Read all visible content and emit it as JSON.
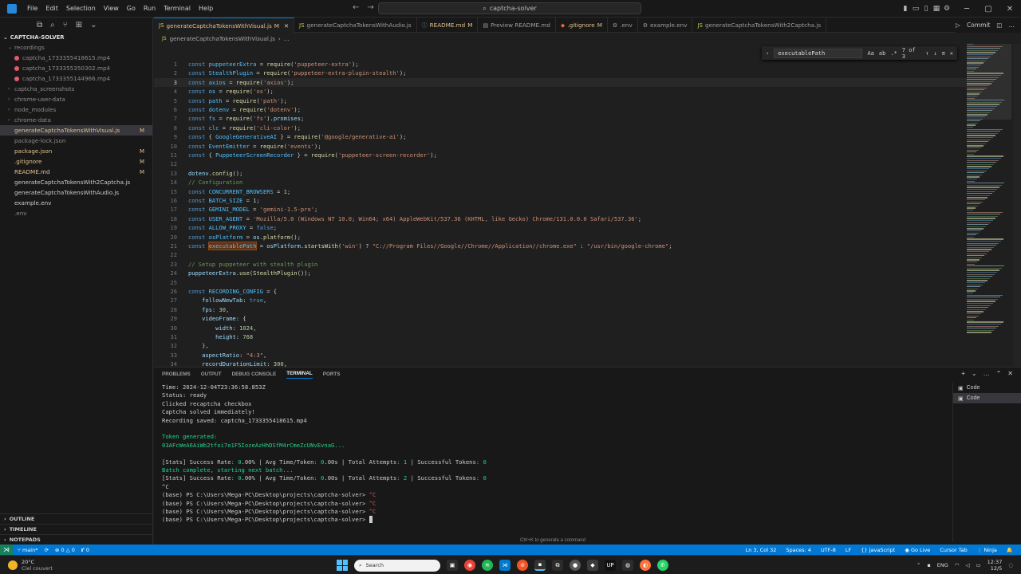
{
  "titlebar": {
    "menu": [
      "File",
      "Edit",
      "Selection",
      "View",
      "Go",
      "Run",
      "Terminal",
      "Help"
    ],
    "search": "captcha-solver"
  },
  "explorer": {
    "root": "CAPTCHA-SOLVER",
    "items": [
      {
        "label": "recordings",
        "type": "folder",
        "open": true,
        "indent": 1,
        "color": "#8c8c8c"
      },
      {
        "label": "captcha_1733355418615.mp4",
        "type": "mp4",
        "indent": 2,
        "color": "#8c8c8c"
      },
      {
        "label": "captcha_1733355350302.mp4",
        "type": "mp4",
        "indent": 2,
        "color": "#8c8c8c"
      },
      {
        "label": "captcha_1733355144966.mp4",
        "type": "mp4",
        "indent": 2,
        "color": "#8c8c8c"
      },
      {
        "label": "captcha_screenshots",
        "type": "folder",
        "indent": 1,
        "color": "#8c8c8c"
      },
      {
        "label": "chrome-user-data",
        "type": "folder",
        "indent": 1,
        "color": "#8c8c8c"
      },
      {
        "label": "node_modules",
        "type": "folder",
        "indent": 1,
        "color": "#8c8c8c"
      },
      {
        "label": "chrome-data",
        "type": "folder",
        "indent": 1,
        "color": "#8c8c8c"
      },
      {
        "label": "generateCaptchaTokensWithVisual.js",
        "type": "js",
        "indent": 1,
        "color": "#e2c08d",
        "badge": "M",
        "active": true
      },
      {
        "label": "package-lock.json",
        "type": "json",
        "indent": 1,
        "color": "#8c8c8c"
      },
      {
        "label": "package.json",
        "type": "json",
        "indent": 1,
        "color": "#e2c08d",
        "badge": "M"
      },
      {
        "label": ".gitignore",
        "type": "git",
        "indent": 1,
        "color": "#e2c08d",
        "badge": "M"
      },
      {
        "label": "README.md",
        "type": "md",
        "indent": 1,
        "color": "#e2c08d",
        "badge": "M"
      },
      {
        "label": "generateCaptchaTokensWith2Captcha.js",
        "type": "js",
        "indent": 1,
        "color": "#cccccc"
      },
      {
        "label": "generateCaptchaTokensWithAudio.js",
        "type": "js",
        "indent": 1,
        "color": "#cccccc"
      },
      {
        "label": "example.env",
        "type": "env",
        "indent": 1,
        "color": "#cccccc"
      },
      {
        "label": ".env",
        "type": "env",
        "indent": 1,
        "color": "#8c8c8c"
      }
    ],
    "bottom": [
      "OUTLINE",
      "TIMELINE",
      "NOTEPADS"
    ]
  },
  "tabs": [
    {
      "label": "generateCaptchaTokensWithVisual.js",
      "mod": "M",
      "active": true,
      "icon": "JS",
      "iconColor": "#cbcb41"
    },
    {
      "label": "generateCaptchaTokensWithAudio.js",
      "icon": "JS",
      "iconColor": "#cbcb41"
    },
    {
      "label": "README.md",
      "mod": "M",
      "icon": "ⓘ",
      "iconColor": "#519aba"
    },
    {
      "label": "Preview README.md",
      "icon": "▤",
      "iconColor": "#9d9d9d"
    },
    {
      "label": ".gitignore",
      "mod": "M",
      "icon": "◆",
      "iconColor": "#e4672f"
    },
    {
      "label": ".env",
      "icon": "⚙",
      "iconColor": "#9d9d9d"
    },
    {
      "label": "example.env",
      "icon": "⚙",
      "iconColor": "#9d9d9d"
    },
    {
      "label": "generateCaptchaTokensWith2Captcha.js",
      "icon": "JS",
      "iconColor": "#cbcb41"
    }
  ],
  "tab_actions": {
    "commit": "Commit"
  },
  "breadcrumb": [
    "generateCaptchaTokensWithVisual.js",
    "..."
  ],
  "find": {
    "query": "executablePath",
    "count": "7 of 3",
    "aa": "Aa",
    "ab": "ab",
    "re": ".*"
  },
  "code": [
    [
      [
        "k",
        "const "
      ],
      [
        "v",
        "puppeteerExtra"
      ],
      [
        "p",
        " = "
      ],
      [
        "f",
        "require"
      ],
      [
        "p",
        "("
      ],
      [
        "s",
        "'puppeteer-extra'"
      ],
      [
        "p",
        ");"
      ]
    ],
    [
      [
        "k",
        "const "
      ],
      [
        "v",
        "StealthPlugin"
      ],
      [
        "p",
        " = "
      ],
      [
        "f",
        "require"
      ],
      [
        "p",
        "("
      ],
      [
        "s",
        "'puppeteer-extra-plugin-stealth'"
      ],
      [
        "p",
        ");"
      ]
    ],
    [
      [
        "k",
        "const "
      ],
      [
        "v",
        "axios"
      ],
      [
        "p",
        " = "
      ],
      [
        "f",
        "require"
      ],
      [
        "p",
        "("
      ],
      [
        "s",
        "'axios'"
      ],
      [
        "p",
        ");"
      ]
    ],
    [
      [
        "k",
        "const "
      ],
      [
        "v",
        "os"
      ],
      [
        "p",
        " = "
      ],
      [
        "f",
        "require"
      ],
      [
        "p",
        "("
      ],
      [
        "s",
        "'os'"
      ],
      [
        "p",
        ");"
      ]
    ],
    [
      [
        "k",
        "const "
      ],
      [
        "v",
        "path"
      ],
      [
        "p",
        " = "
      ],
      [
        "f",
        "require"
      ],
      [
        "p",
        "("
      ],
      [
        "s",
        "'path'"
      ],
      [
        "p",
        ");"
      ]
    ],
    [
      [
        "k",
        "const "
      ],
      [
        "v",
        "dotenv"
      ],
      [
        "p",
        " = "
      ],
      [
        "f",
        "require"
      ],
      [
        "p",
        "("
      ],
      [
        "s",
        "'dotenv'"
      ],
      [
        "p",
        ");"
      ]
    ],
    [
      [
        "k",
        "const "
      ],
      [
        "v",
        "fs"
      ],
      [
        "p",
        " = "
      ],
      [
        "f",
        "require"
      ],
      [
        "p",
        "("
      ],
      [
        "s",
        "'fs'"
      ],
      [
        "p",
        ")."
      ],
      [
        "pr",
        "promises"
      ],
      [
        "p",
        ";"
      ]
    ],
    [
      [
        "k",
        "const "
      ],
      [
        "v",
        "clc"
      ],
      [
        "p",
        " = "
      ],
      [
        "f",
        "require"
      ],
      [
        "p",
        "("
      ],
      [
        "s",
        "'cli-color'"
      ],
      [
        "p",
        ");"
      ]
    ],
    [
      [
        "k",
        "const "
      ],
      [
        "p",
        "{ "
      ],
      [
        "v",
        "GoogleGenerativeAI"
      ],
      [
        "p",
        " } = "
      ],
      [
        "f",
        "require"
      ],
      [
        "p",
        "("
      ],
      [
        "s",
        "'@google/generative-ai'"
      ],
      [
        "p",
        ");"
      ]
    ],
    [
      [
        "k",
        "const "
      ],
      [
        "v",
        "EventEmitter"
      ],
      [
        "p",
        " = "
      ],
      [
        "f",
        "require"
      ],
      [
        "p",
        "("
      ],
      [
        "s",
        "'events'"
      ],
      [
        "p",
        ");"
      ]
    ],
    [
      [
        "k",
        "const "
      ],
      [
        "p",
        "{ "
      ],
      [
        "v",
        "PuppeteerScreenRecorder"
      ],
      [
        "p",
        " } = "
      ],
      [
        "f",
        "require"
      ],
      [
        "p",
        "("
      ],
      [
        "s",
        "'puppeteer-screen-recorder'"
      ],
      [
        "p",
        ");"
      ]
    ],
    [],
    [
      [
        "pr",
        "dotenv"
      ],
      [
        "p",
        "."
      ],
      [
        "f",
        "config"
      ],
      [
        "p",
        "();"
      ]
    ],
    [
      [
        "c",
        "// Configuration"
      ]
    ],
    [
      [
        "k",
        "const "
      ],
      [
        "v",
        "CONCURRENT_BROWSERS"
      ],
      [
        "p",
        " = "
      ],
      [
        "n",
        "1"
      ],
      [
        "p",
        ";"
      ]
    ],
    [
      [
        "k",
        "const "
      ],
      [
        "v",
        "BATCH_SIZE"
      ],
      [
        "p",
        " = "
      ],
      [
        "n",
        "1"
      ],
      [
        "p",
        ";"
      ]
    ],
    [
      [
        "k",
        "const "
      ],
      [
        "v",
        "GEMINI_MODEL"
      ],
      [
        "p",
        " = "
      ],
      [
        "s",
        "'gemini-1.5-pro'"
      ],
      [
        "p",
        ";"
      ]
    ],
    [
      [
        "k",
        "const "
      ],
      [
        "v",
        "USER_AGENT"
      ],
      [
        "p",
        " = "
      ],
      [
        "s",
        "'Mozilla/5.0 (Windows NT 10.0; Win64; x64) AppleWebKit/537.36 (KHTML, like Gecko) Chrome/131.0.0.0 Safari/537.36'"
      ],
      [
        "p",
        ";"
      ]
    ],
    [
      [
        "k",
        "const "
      ],
      [
        "v",
        "ALLOW_PROXY"
      ],
      [
        "p",
        " = "
      ],
      [
        "b",
        "false"
      ],
      [
        "p",
        ";"
      ]
    ],
    [
      [
        "k",
        "const "
      ],
      [
        "v",
        "osPlatform"
      ],
      [
        "p",
        " = "
      ],
      [
        "pr",
        "os"
      ],
      [
        "p",
        "."
      ],
      [
        "f",
        "platform"
      ],
      [
        "p",
        "();"
      ]
    ],
    [
      [
        "k",
        "const "
      ],
      [
        "h",
        "executablePath"
      ],
      [
        "p",
        " = "
      ],
      [
        "pr",
        "osPlatform"
      ],
      [
        "p",
        "."
      ],
      [
        "f",
        "startsWith"
      ],
      [
        "p",
        "("
      ],
      [
        "s",
        "'win'"
      ],
      [
        "p",
        ") ? "
      ],
      [
        "s",
        "\"C://Program Files//Google//Chrome//Application//chrome.exe\""
      ],
      [
        "p",
        " : "
      ],
      [
        "s",
        "\"/usr/bin/google-chrome\""
      ],
      [
        "p",
        ";"
      ]
    ],
    [],
    [
      [
        "c",
        "// Setup puppeteer with stealth plugin"
      ]
    ],
    [
      [
        "pr",
        "puppeteerExtra"
      ],
      [
        "p",
        "."
      ],
      [
        "f",
        "use"
      ],
      [
        "p",
        "("
      ],
      [
        "f",
        "StealthPlugin"
      ],
      [
        "p",
        "());"
      ]
    ],
    [],
    [
      [
        "k",
        "const "
      ],
      [
        "v",
        "RECORDING_CONFIG"
      ],
      [
        "p",
        " = {"
      ]
    ],
    [
      [
        "p",
        "    "
      ],
      [
        "pr",
        "followNewTab"
      ],
      [
        "p",
        ": "
      ],
      [
        "b",
        "true"
      ],
      [
        "p",
        ","
      ]
    ],
    [
      [
        "p",
        "    "
      ],
      [
        "pr",
        "fps"
      ],
      [
        "p",
        ": "
      ],
      [
        "n",
        "30"
      ],
      [
        "p",
        ","
      ]
    ],
    [
      [
        "p",
        "    "
      ],
      [
        "pr",
        "videoFrame"
      ],
      [
        "p",
        ": {"
      ]
    ],
    [
      [
        "p",
        "        "
      ],
      [
        "pr",
        "width"
      ],
      [
        "p",
        ": "
      ],
      [
        "n",
        "1024"
      ],
      [
        "p",
        ","
      ]
    ],
    [
      [
        "p",
        "        "
      ],
      [
        "pr",
        "height"
      ],
      [
        "p",
        ": "
      ],
      [
        "n",
        "768"
      ]
    ],
    [
      [
        "p",
        "    },"
      ]
    ],
    [
      [
        "p",
        "    "
      ],
      [
        "pr",
        "aspectRatio"
      ],
      [
        "p",
        ": "
      ],
      [
        "s",
        "\"4:3\""
      ],
      [
        "p",
        ","
      ]
    ],
    [
      [
        "p",
        "    "
      ],
      [
        "pr",
        "recordDurationLimit"
      ],
      [
        "p",
        ": "
      ],
      [
        "n",
        "300"
      ],
      [
        "p",
        ","
      ]
    ]
  ],
  "cursor_line": 3,
  "panel": {
    "tabs": [
      "PROBLEMS",
      "OUTPUT",
      "DEBUG CONSOLE",
      "TERMINAL",
      "PORTS"
    ],
    "active": "TERMINAL",
    "terminal": [
      {
        "t": "Time: 2024-12-04T23:36:58.853Z"
      },
      {
        "t": "Status: ready"
      },
      {
        "t": "Clicked recaptcha checkbox"
      },
      {
        "t": "Captcha solved immediately!"
      },
      {
        "t": "Recording saved: captcha_1733355418615.mp4"
      },
      {
        "t": ""
      },
      {
        "t": "Token generated:",
        "c": "green"
      },
      {
        "t": "03AFcWeA6AiWb2tfoi7e1F5IozeAzHhDSfM4rCmeZcUNvEvnaG...",
        "c": "green"
      },
      {
        "t": ""
      },
      {
        "t": "[Stats] Success Rate: 0.00% | Avg Time/Token: 0.00s | Total Attempts: 1 | Successful Tokens: 0"
      },
      {
        "t": "Batch complete, starting next batch...",
        "c": "green"
      },
      {
        "t": "[Stats] Success Rate: 0.00% | Avg Time/Token: 0.00s | Total Attempts: 2 | Successful Tokens: 0"
      },
      {
        "t": "^C"
      },
      {
        "t": "(base) PS C:\\Users\\Mega-PC\\Desktop\\projects\\captcha-solver> ^C"
      },
      {
        "t": "(base) PS C:\\Users\\Mega-PC\\Desktop\\projects\\captcha-solver> ^C"
      },
      {
        "t": "(base) PS C:\\Users\\Mega-PC\\Desktop\\projects\\captcha-solver> ^C"
      },
      {
        "t": "(base) PS C:\\Users\\Mega-PC\\Desktop\\projects\\captcha-solver> "
      }
    ],
    "terminals": [
      "Code",
      "Code"
    ],
    "hint": "Ctrl+K to generate a command"
  },
  "statusbar": {
    "branch": "main*",
    "errors": "0",
    "warnings": "0",
    "ports": "0",
    "position": "Ln 3, Col 32",
    "spaces": "Spaces: 4",
    "encoding": "UTF-8",
    "eol": "LF",
    "language": "JavaScript",
    "golive": "Go Live",
    "cursortab": "Cursor Tab",
    "ninja": "Ninja"
  },
  "taskbar": {
    "temp": "20°C",
    "weather": "Ciel couvert",
    "search": "Search",
    "lang": "ENG",
    "time": "12:37",
    "date": "12/5"
  }
}
